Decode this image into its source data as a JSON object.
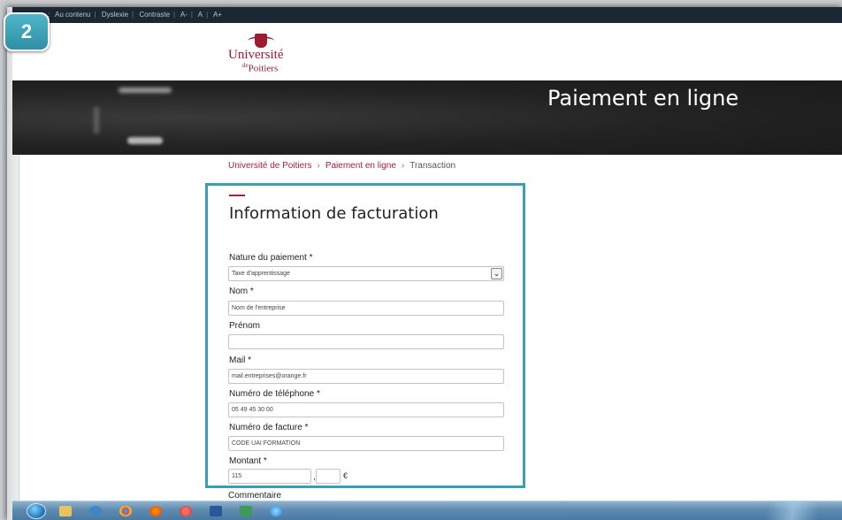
{
  "badge": {
    "number": "2"
  },
  "access_bar": {
    "items": [
      "Au contenu",
      "Dyslexie",
      "Contraste",
      "A-",
      "A",
      "A+"
    ],
    "lead": ":"
  },
  "header": {
    "logo_name": "Université",
    "logo_sub_prefix": "de",
    "logo_sub": "Poitiers"
  },
  "hero": {
    "title": "Paiement en ligne"
  },
  "breadcrumb": {
    "items": [
      "Université de Poitiers",
      "Paiement en ligne",
      "Transaction"
    ]
  },
  "form": {
    "title": "Information de facturation",
    "fields": {
      "nature": {
        "label": "Nature du paiement *",
        "value": "Taxe d'apprentissage"
      },
      "nom": {
        "label": "Nom *",
        "value": "Nom de l'entreprise"
      },
      "prenom": {
        "label": "Prénom",
        "value": ""
      },
      "mail": {
        "label": "Mail *",
        "value": "mail.entreprises@orange.fr"
      },
      "telephone": {
        "label": "Numéro de téléphone *",
        "value": "05 49 45 30 00"
      },
      "facture": {
        "label": "Numéro de facture *",
        "value": "CODE UAI FORMATION"
      },
      "montant": {
        "label": "Montant *",
        "value_int": "115",
        "value_dec": "",
        "separator": ",",
        "currency": "€"
      },
      "commentaire": {
        "label": "Commentaire"
      }
    }
  },
  "colors": {
    "highlight": "#3a9fb4",
    "brand": "#a0243a",
    "access_bar": "#1b2733"
  },
  "taskbar": {
    "icons": [
      "windows-start-icon",
      "file-explorer-icon",
      "media-player-icon",
      "chrome-icon",
      "firefox-icon",
      "opera-icon",
      "word-icon",
      "excel-icon",
      "internet-explorer-icon"
    ]
  }
}
